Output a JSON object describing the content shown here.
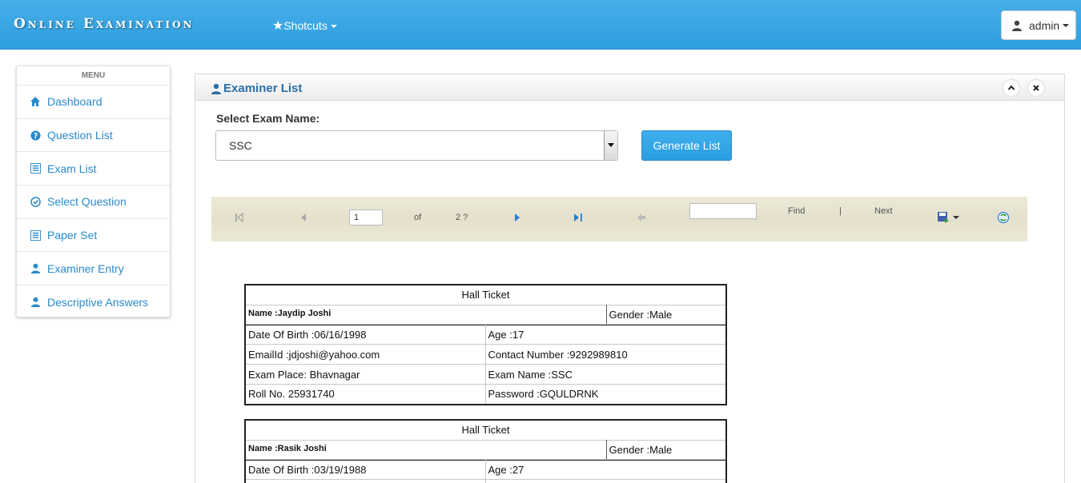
{
  "navbar": {
    "brand": "Online Examination",
    "shortcuts_label": "Shotcuts",
    "user_label": "admin"
  },
  "sidebar": {
    "heading": "MENU",
    "items": [
      {
        "label": "Dashboard",
        "icon": "home-icon"
      },
      {
        "label": "Question List",
        "icon": "question-circle-icon"
      },
      {
        "label": "Exam List",
        "icon": "list-icon"
      },
      {
        "label": "Select Question",
        "icon": "check-circle-icon"
      },
      {
        "label": "Paper Set",
        "icon": "list-icon"
      },
      {
        "label": "Examiner Entry",
        "icon": "user-icon"
      },
      {
        "label": "Descriptive Answers",
        "icon": "user-icon"
      }
    ]
  },
  "panel": {
    "title": "Examiner List",
    "select_label": "Select Exam Name:",
    "selected_exam": "SSC",
    "generate_button": "Generate List"
  },
  "toolbar": {
    "current_page": "1",
    "of_label": "of",
    "total_pages": "2 ?",
    "find_label": "Find",
    "separator": "|",
    "next_label": "Next"
  },
  "tickets": [
    {
      "title": "Hall Ticket",
      "name": "Name :Jaydip Joshi",
      "gender": "Gender :Male",
      "dob": "Date Of Birth :06/16/1998",
      "age": "Age :17",
      "email": "EmailId :jdjoshi@yahoo.com",
      "contact": "Contact Number :9292989810",
      "place": "Exam Place: Bhavnagar",
      "exam": "Exam Name :SSC",
      "roll": "Roll No. 25931740",
      "password": "Password :GQULDRNK"
    },
    {
      "title": "Hall Ticket",
      "name": "Name :Rasik Joshi",
      "gender": "Gender :Male",
      "dob": "Date Of Birth :03/19/1988",
      "age": "Age :27"
    }
  ],
  "colors": {
    "navbar": "#3aa8e6",
    "link": "#2a8ac9",
    "panel_title": "#2a6fa8",
    "button": "#2f9fe0"
  }
}
